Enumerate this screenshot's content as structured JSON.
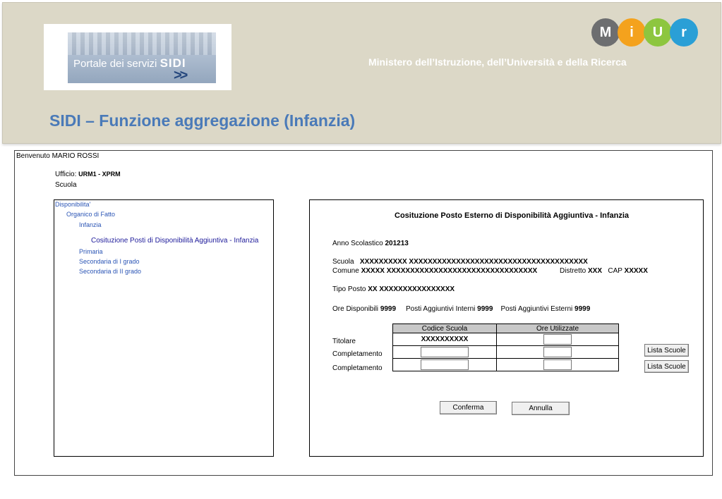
{
  "header": {
    "logo_text": "Portale dei servizi",
    "logo_brand": "SIDI",
    "logo_arrows": ">>",
    "miur_letters": [
      "M",
      "i",
      "U",
      "r"
    ],
    "miur_colors": [
      "#6d6e70",
      "#f4a21d",
      "#8dc63f",
      "#2a9fd6"
    ],
    "ministry": "Ministero dell’Istruzione, dell’Università e della Ricerca",
    "title": "SIDI – Funzione aggregazione (Infanzia)",
    "title_color": "#4a7ab8"
  },
  "user": {
    "welcome": "Benvenuto MARIO ROSSI",
    "ufficio_label": "Ufficio:",
    "ufficio_value": "URM1 - XPRM",
    "scuola_label": "Scuola"
  },
  "tree": {
    "items": [
      "Disponibilita'",
      "Organico di Fatto",
      "Infanzia",
      "Cosituzione Posti di Disponibilità Aggiuntiva - Infanzia",
      "Primaria",
      "Secondaria di I grado",
      "Secondaria di II grado"
    ]
  },
  "form": {
    "title": "Cosituzione Posto Esterno di Disponibilità Aggiuntiva  - Infanzia",
    "anno_label": "Anno Scolastico",
    "anno_value": "201213",
    "scuola_label": "Scuola",
    "scuola_value": "XXXXXXXXXX XXXXXXXXXXXXXXXXXXXXXXXXXXXXXXXXXXXXXX",
    "comune_label": "Comune",
    "comune_value": "XXXXX XXXXXXXXXXXXXXXXXXXXXXXXXXXXXXXX",
    "distretto_label": "Distretto",
    "distretto_value": "XXX",
    "cap_label": "CAP",
    "cap_value": "XXXXX",
    "tipo_label": "Tipo Posto",
    "tipo_value": "XX  XXXXXXXXXXXXXXXX",
    "ore_disp_label": "Ore Disponibili",
    "ore_disp_value": "9999",
    "posti_int_label": "Posti Aggiuntivi Interni",
    "posti_int_value": "9999",
    "posti_est_label": "Posti Aggiuntivi Esterni",
    "posti_est_value": "9999",
    "table": {
      "headers": [
        "Codice Scuola",
        "Ore Utilizzate"
      ],
      "titolare_code": "XXXXXXXXXX"
    },
    "rows": [
      "Titolare",
      "Completamento",
      "Completamento"
    ],
    "lista_scuole": "Lista Scuole",
    "conferma": "Conferma",
    "annulla": "Annulla"
  }
}
